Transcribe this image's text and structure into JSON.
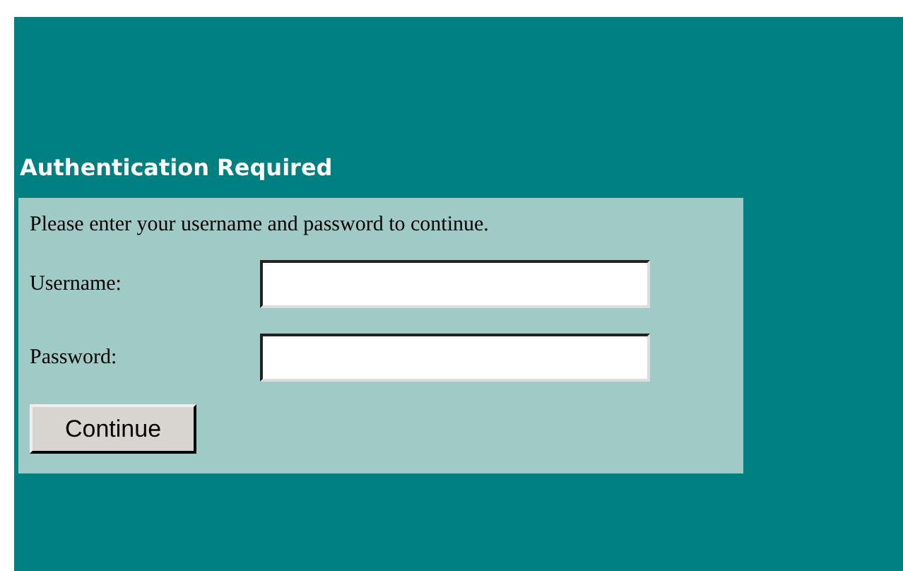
{
  "title": "Authentication Required",
  "instructions": "Please enter your username and password to continue.",
  "fields": [
    {
      "label": "Username:"
    },
    {
      "label": "Password:"
    }
  ],
  "buttons": [
    "Continue"
  ]
}
